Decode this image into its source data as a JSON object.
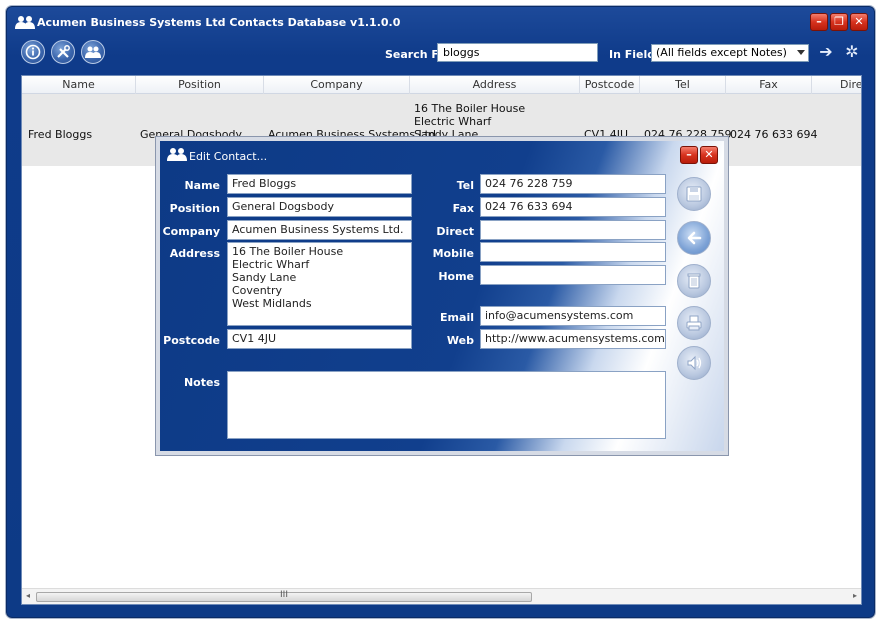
{
  "window": {
    "title": "Acumen Business Systems Ltd Contacts Database v1.1.0.0"
  },
  "toolbar": {
    "search_label": "Search For",
    "search_value": "bloggs",
    "fields_label": "In Fields",
    "fields_selected": "(All fields except Notes)"
  },
  "grid": {
    "columns": [
      "Name",
      "Position",
      "Company",
      "Address",
      "Postcode",
      "Tel",
      "Fax",
      "Direc"
    ],
    "row": {
      "name": "Fred Bloggs",
      "position": "General Dogsbody",
      "company": "Acumen Business Systems Ltd",
      "address_line1": "16 The Boiler House",
      "address_line2": "Electric Wharf",
      "address_line3": "Sandy Lane",
      "postcode": "CV1 4JU",
      "tel": "024 76 228 759",
      "fax": "024 76 633 694"
    },
    "scroll_grip": "III"
  },
  "dialog": {
    "title": "Edit Contact...",
    "labels": {
      "name": "Name",
      "position": "Position",
      "company": "Company",
      "address": "Address",
      "postcode": "Postcode",
      "notes": "Notes",
      "tel": "Tel",
      "fax": "Fax",
      "direct": "Direct",
      "mobile": "Mobile",
      "home": "Home",
      "email": "Email",
      "web": "Web"
    },
    "values": {
      "name": "Fred Bloggs",
      "position": "General Dogsbody",
      "company": "Acumen Business Systems Ltd.",
      "address": "16 The Boiler House\nElectric Wharf\nSandy Lane\nCoventry\nWest Midlands",
      "postcode": "CV1 4JU",
      "notes": "",
      "tel": "024 76 228 759",
      "fax": "024 76 633 694",
      "direct": "",
      "mobile": "",
      "home": "",
      "email": "info@acumensystems.com",
      "web": "http://www.acumensystems.com"
    }
  },
  "icons": {
    "app": "users-icon",
    "info": "info-icon",
    "tools": "tools-icon",
    "contacts": "users-icon",
    "search_go": "arrow-right-icon",
    "settings": "gear-icon",
    "save": "save-icon",
    "back": "arrow-left-icon",
    "delete": "trash-icon",
    "print": "print-icon",
    "speak": "speaker-icon"
  },
  "colors": {
    "frame": "#0d3a86",
    "close_button": "#d7321e",
    "row_highlight": "#e8e8e8"
  }
}
